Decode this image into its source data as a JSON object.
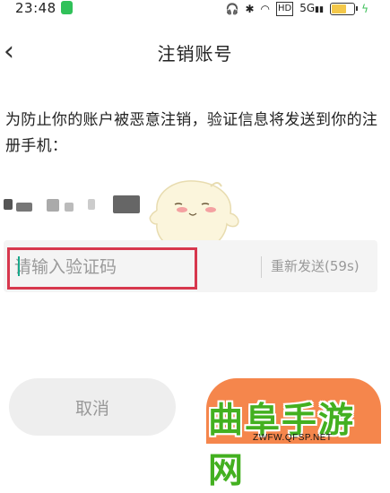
{
  "status_bar": {
    "time": "23:48",
    "network_badge": "HD",
    "signal": "5G"
  },
  "header": {
    "back_glyph": "‹",
    "title": "注销账号"
  },
  "main": {
    "instruction": "为防止你的账户被恶意注销，验证信息将发送到你的注册手机：",
    "verification_code_placeholder": "请输入验证码",
    "resend_label": "重新发送(59s)"
  },
  "footer": {
    "cancel_label": "取消"
  },
  "watermark": {
    "title": "曲阜手游网",
    "url": "ZWFW.QFSP.NET"
  },
  "colors": {
    "accent_orange": "#f5864c",
    "caret_green": "#17a88b",
    "highlight_red": "#d7374d",
    "watermark_green": "#43b020"
  },
  "icons": [
    "headphones-icon",
    "bluetooth-icon",
    "wifi-icon",
    "signal-icon",
    "battery-icon",
    "back-chevron-icon"
  ]
}
